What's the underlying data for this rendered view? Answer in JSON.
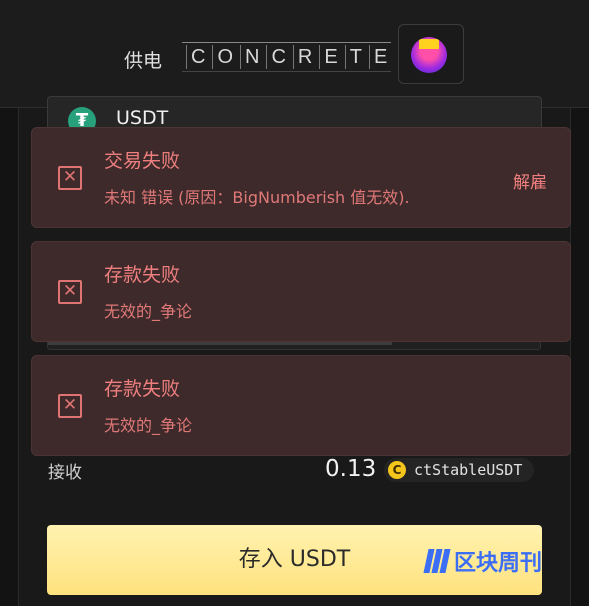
{
  "header": {
    "powered_by": "供电",
    "brand_letters": [
      "C",
      "O",
      "N",
      "C",
      "R",
      "E",
      "T",
      "E"
    ]
  },
  "form": {
    "token": {
      "symbol": "USDT",
      "icon": "tether-icon",
      "icon_color": "#26a17b"
    },
    "amount_bar_fill": 0.7,
    "receive": {
      "label": "接收",
      "amount": "0.13",
      "token_name": "ctStableUSDT",
      "token_icon_char": "C"
    },
    "deposit_button": "存入 USDT"
  },
  "toasts": [
    {
      "title": "交易失败",
      "message": "未知 错误 (原因：BigNumberish 值无效).",
      "dismiss": "解雇"
    },
    {
      "title": "存款失败",
      "message": "无效的_争论"
    },
    {
      "title": "存款失败",
      "message": "无效的_争论"
    }
  ],
  "watermark": {
    "text": "区块周刊"
  },
  "colors": {
    "toast_bg": "#3e2a2a",
    "toast_text": "#ef7f7f",
    "button_yellow": "#ffe27e",
    "watermark_blue": "#3b6ef5"
  }
}
